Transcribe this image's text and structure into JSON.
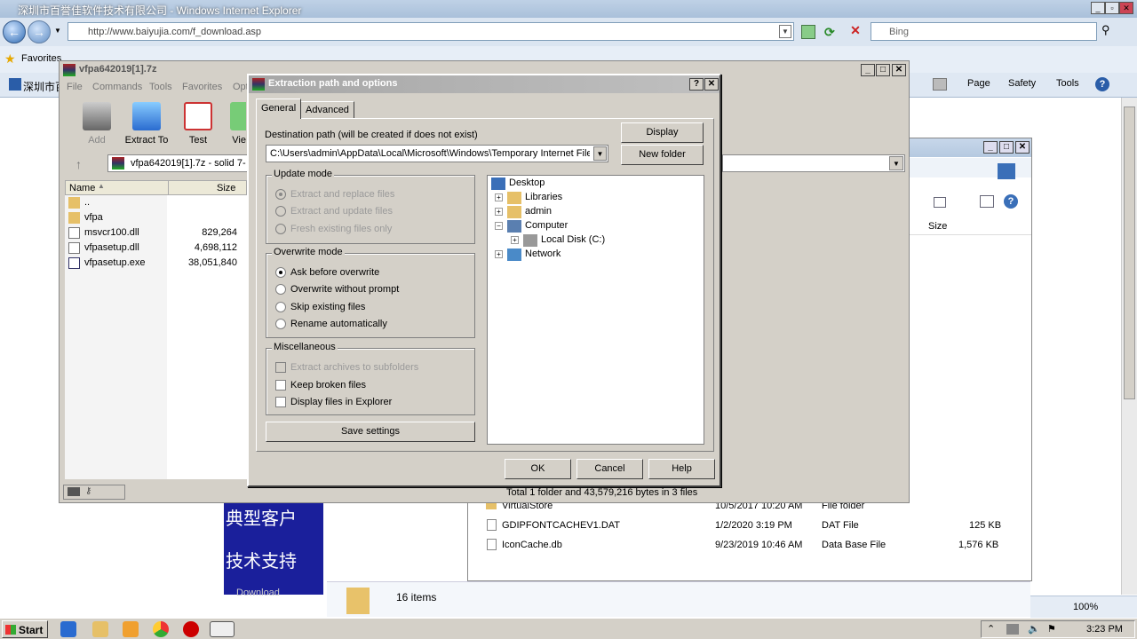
{
  "ie": {
    "title": "深圳市百誉佳软件技术有限公司 - Windows Internet Explorer",
    "url": "http://www.baiyujia.com/f_download.asp",
    "search_placeholder": "Bing",
    "favorites": "Favorites",
    "tab_title": "深圳市百",
    "cmd_page": "Page",
    "cmd_safety": "Safety",
    "cmd_tools": "Tools",
    "zoom": "100%"
  },
  "page": {
    "line1": "典型客户",
    "line2": "技术支持",
    "line3": "Download"
  },
  "explorer": {
    "size_header": "Size",
    "items_count": "16 items",
    "rows": [
      {
        "name": "VirtualStore",
        "date": "10/5/2017 10:20 AM",
        "type": "File folder",
        "size": ""
      },
      {
        "name": "GDIPFONTCACHEV1.DAT",
        "date": "1/2/2020 3:19 PM",
        "type": "DAT File",
        "size": "125 KB"
      },
      {
        "name": "IconCache.db",
        "date": "9/23/2019 10:46 AM",
        "type": "Data Base File",
        "size": "1,576 KB"
      }
    ]
  },
  "winrar": {
    "title": "vfpa642019[1].7z",
    "menu": [
      "File",
      "Commands",
      "Tools",
      "Favorites",
      "Opt"
    ],
    "tools": {
      "add": "Add",
      "extract": "Extract To",
      "test": "Test",
      "view": "Vie"
    },
    "path": "vfpa642019[1].7z - solid 7-",
    "col_name": "Name",
    "col_size": "Size",
    "files": [
      {
        "name": "..",
        "size": ""
      },
      {
        "name": "vfpa",
        "size": ""
      },
      {
        "name": "msvcr100.dll",
        "size": "829,264"
      },
      {
        "name": "vfpasetup.dll",
        "size": "4,698,112"
      },
      {
        "name": "vfpasetup.exe",
        "size": "38,051,840"
      }
    ],
    "status": "Total 1 folder and 43,579,216 bytes in 3 files"
  },
  "dialog": {
    "title": "Extraction path and options",
    "tab_general": "General",
    "tab_advanced": "Advanced",
    "dest_label": "Destination path (will be created if does not exist)",
    "dest_value": "C:\\Users\\admin\\AppData\\Local\\Microsoft\\Windows\\Temporary Internet Files",
    "display_btn": "Display",
    "new_folder_btn": "New folder",
    "update_mode": {
      "label": "Update mode",
      "opt1": "Extract and replace files",
      "opt2": "Extract and update files",
      "opt3": "Fresh existing files only"
    },
    "overwrite_mode": {
      "label": "Overwrite mode",
      "opt1": "Ask before overwrite",
      "opt2": "Overwrite without prompt",
      "opt3": "Skip existing files",
      "opt4": "Rename automatically"
    },
    "misc": {
      "label": "Miscellaneous",
      "opt1": "Extract archives to subfolders",
      "opt2": "Keep broken files",
      "opt3": "Display files in Explorer"
    },
    "save_settings": "Save settings",
    "tree": [
      "Desktop",
      "Libraries",
      "admin",
      "Computer",
      "Local Disk (C:)",
      "Network"
    ],
    "ok": "OK",
    "cancel": "Cancel",
    "help": "Help"
  },
  "taskbar": {
    "start": "Start",
    "clock": "3:23 PM"
  }
}
